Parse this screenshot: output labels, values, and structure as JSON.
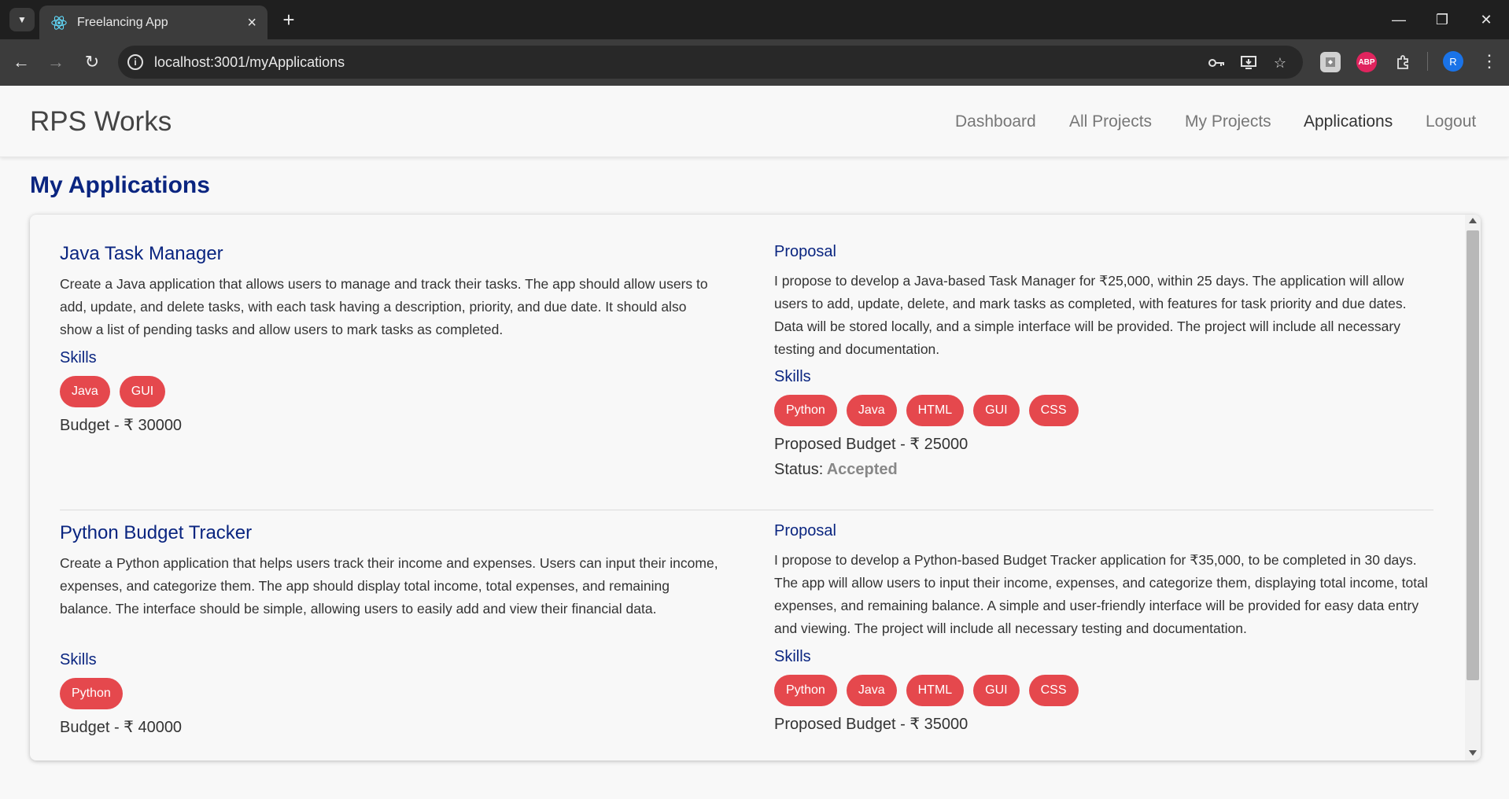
{
  "browser": {
    "tab_title": "Freelancing App",
    "url": "localhost:3001/myApplications",
    "profile_initial": "R",
    "abp_label": "ABP"
  },
  "header": {
    "brand": "RPS Works",
    "nav": [
      "Dashboard",
      "All Projects",
      "My Projects",
      "Applications",
      "Logout"
    ],
    "active": "Applications"
  },
  "page": {
    "title": "My Applications",
    "skills_label": "Skills",
    "proposal_label": "Proposal",
    "status_label": "Status:"
  },
  "applications": [
    {
      "title": "Java Task Manager",
      "description": "Create a Java application that allows users to manage and track their tasks. The app should allow users to add, update, and delete tasks, with each task having a description, priority, and due date. It should also show a list of pending tasks and allow users to mark tasks as completed.",
      "skills": [
        "Java",
        "GUI"
      ],
      "budget": "Budget - ₹ 30000",
      "proposal": "I propose to develop a Java-based Task Manager for ₹25,000, within 25 days. The application will allow users to add, update, delete, and mark tasks as completed, with features for task priority and due dates. Data will be stored locally, and a simple interface will be provided. The project will include all necessary testing and documentation.",
      "proposal_skills": [
        "Python",
        "Java",
        "HTML",
        "GUI",
        "CSS"
      ],
      "proposed_budget": "Proposed Budget - ₹ 25000",
      "status": "Accepted"
    },
    {
      "title": "Python Budget Tracker",
      "description": "Create a Python application that helps users track their income and expenses. Users can input their income, expenses, and categorize them. The app should display total income, total expenses, and remaining balance. The interface should be simple, allowing users to easily add and view their financial data.",
      "skills": [
        "Python"
      ],
      "budget": "Budget - ₹ 40000",
      "proposal": "I propose to develop a Python-based Budget Tracker application for ₹35,000, to be completed in 30 days. The app will allow users to input their income, expenses, and categorize them, displaying total income, total expenses, and remaining balance. A simple and user-friendly interface will be provided for easy data entry and viewing. The project will include all necessary testing and documentation.",
      "proposal_skills": [
        "Python",
        "Java",
        "HTML",
        "GUI",
        "CSS"
      ],
      "proposed_budget": "Proposed Budget - ₹ 35000"
    }
  ],
  "colors": {
    "accent": "#0a2580",
    "chip": "#e5484d",
    "status": "#888888"
  }
}
